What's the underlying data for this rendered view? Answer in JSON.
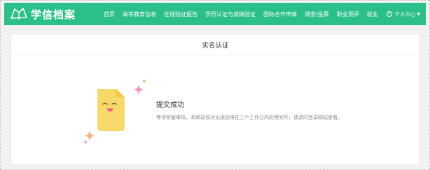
{
  "header": {
    "logo_text": "学信档案",
    "nav": [
      "首页",
      "高等教育信息",
      "在线验证报告",
      "学历认证与成绩验证",
      "国际合作申请",
      "调查/投票",
      "职业测评",
      "就业"
    ],
    "user_label": "个人中心",
    "caret": "▼"
  },
  "card": {
    "title": "实名认证",
    "status_title": "提交成功",
    "status_desc": "等待客服审核，本网站核对无误后将在三个工作日内处理完毕，请及时登录网站查看。"
  },
  "colors": {
    "header_bg": "#2bbf8a",
    "doc_yellow": "#f7d86a",
    "sparkle_pink": "#f19ac0",
    "sparkle_orange": "#f5b47b"
  }
}
